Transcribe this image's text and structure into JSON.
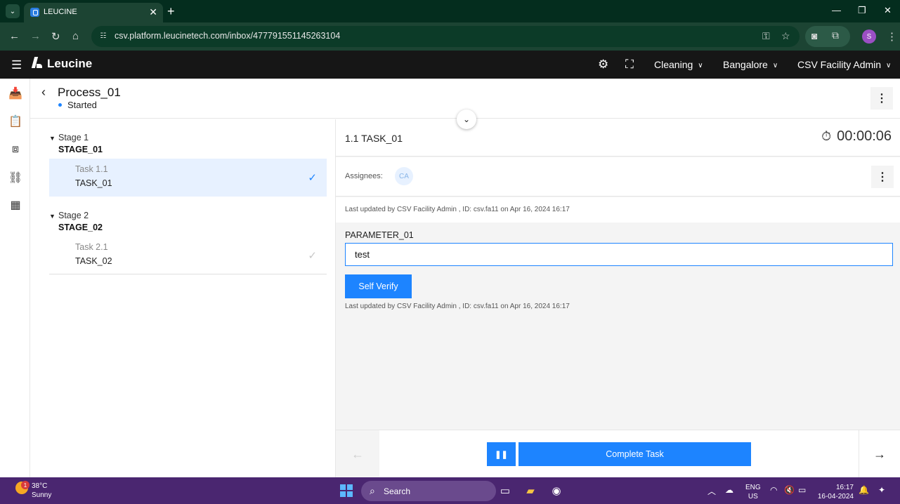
{
  "browser": {
    "tab_title": "LEUCINE",
    "url": "csv.platform.leucinetech.com/inbox/477791551145263104",
    "profile_initial": "S"
  },
  "app": {
    "brand": "Leucine",
    "use_case": "Cleaning",
    "facility": "Bangalore",
    "user": "CSV Facility Admin"
  },
  "process": {
    "title": "Process_01",
    "status": "Started"
  },
  "stages": [
    {
      "number": "Stage 1",
      "name": "STAGE_01",
      "tasks": [
        {
          "number": "Task 1.1",
          "name": "TASK_01"
        }
      ]
    },
    {
      "number": "Stage 2",
      "name": "STAGE_02",
      "tasks": [
        {
          "number": "Task 2.1",
          "name": "TASK_02"
        }
      ]
    }
  ],
  "task": {
    "title": "1.1 TASK_01",
    "timer": "00:00:06",
    "assignees_label": "Assignees:",
    "assignee_initials": "CA",
    "last_updated": "Last updated by CSV Facility Admin , ID: csv.fa11 on Apr 16, 2024 16:17",
    "parameter_label": "PARAMETER_01",
    "parameter_value": "test",
    "self_verify_label": "Self Verify",
    "param_last_updated": "Last updated by CSV Facility Admin , ID: csv.fa11 on Apr 16, 2024 16:17",
    "complete_label": "Complete Task"
  },
  "taskbar": {
    "weather_badge": "1",
    "weather_temp": "38°C",
    "weather_desc": "Sunny",
    "search_label": "Search",
    "lang_line1": "ENG",
    "lang_line2": "US",
    "time": "16:17",
    "date": "16-04-2024"
  },
  "colors": {
    "primary": "#1d84ff",
    "header_bg": "#161616",
    "browser_bg": "#1c4433",
    "taskbar_bg": "#4a2670"
  }
}
